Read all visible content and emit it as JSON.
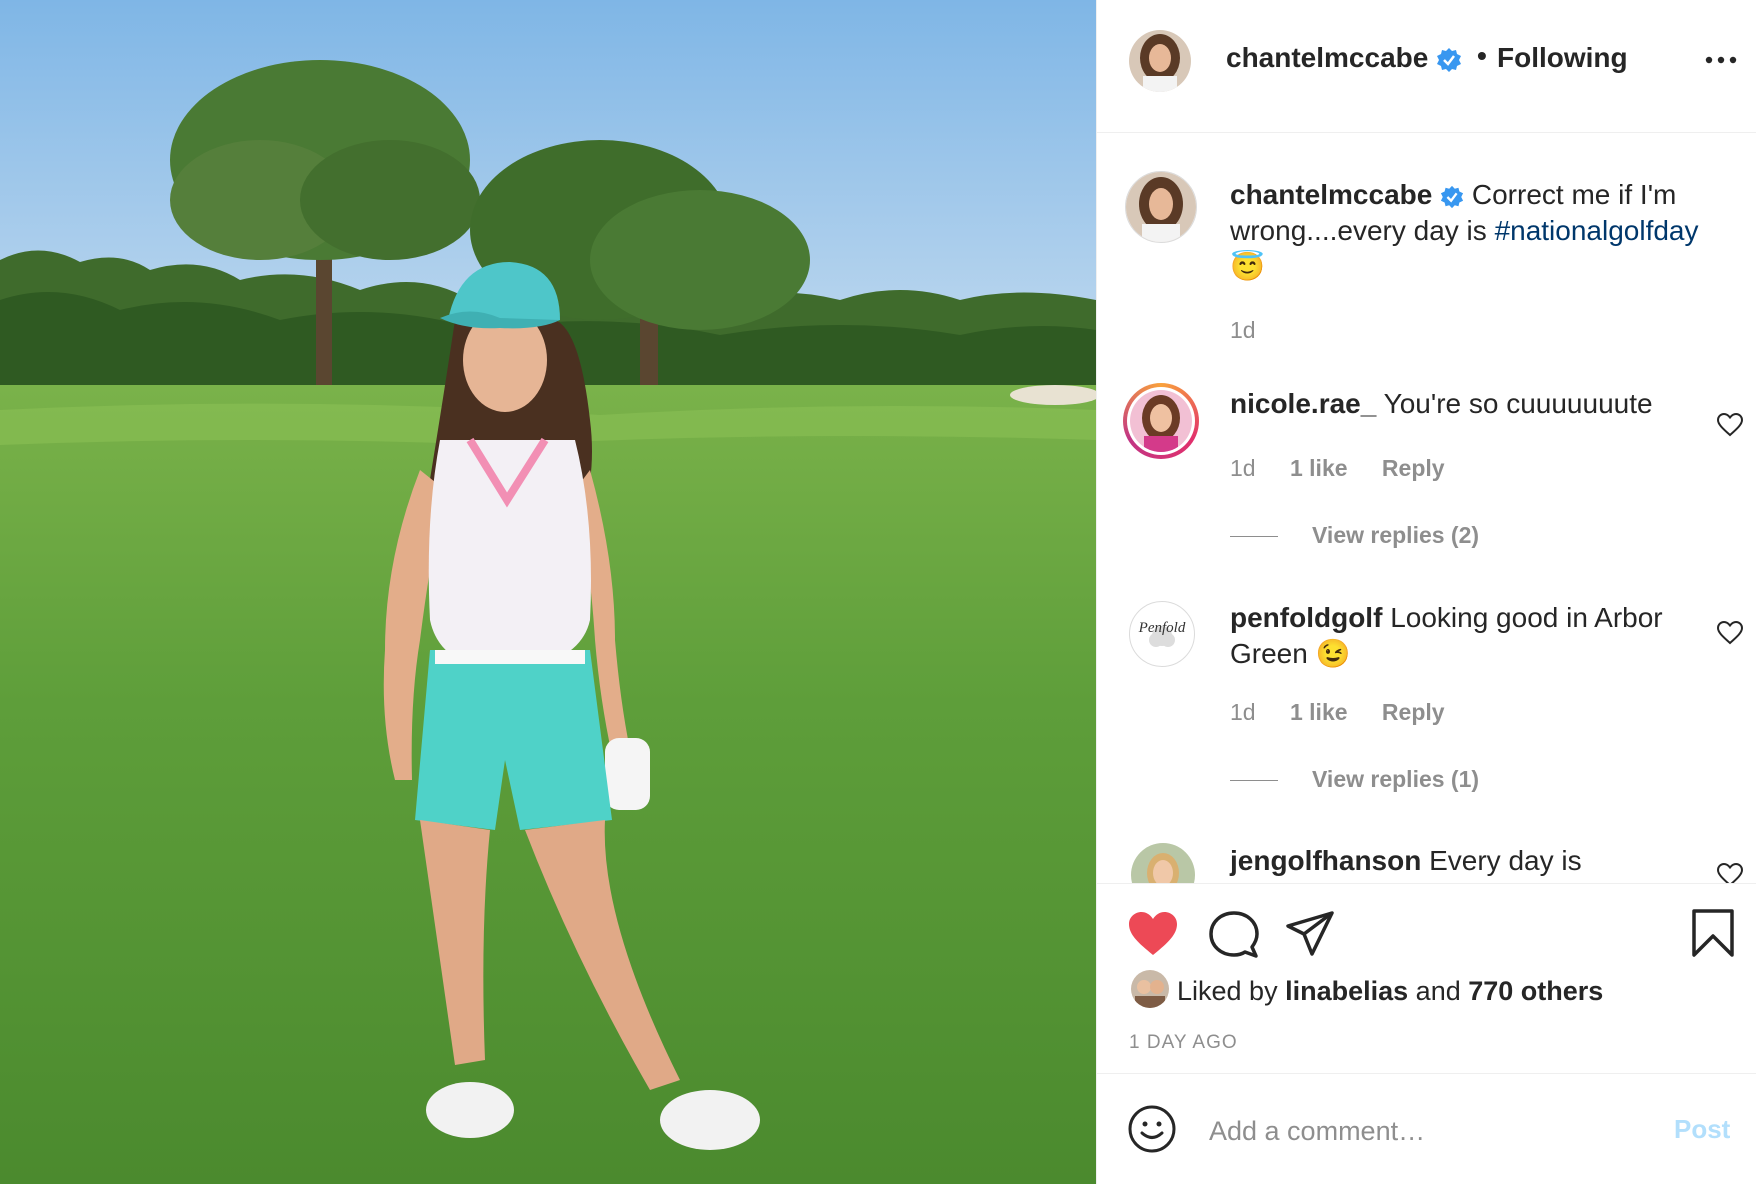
{
  "post": {
    "author": "chantelmccabe",
    "separator": "•",
    "follow_status": "Following",
    "more_icon": "more-options-icon",
    "colors": {
      "verified": "#3897f0",
      "like_red": "#ed4956",
      "link": "#00376b",
      "muted": "#8e8e8e",
      "post_disabled": "#b2dffc"
    }
  },
  "caption": {
    "username": "chantelmccabe",
    "text_before": "Correct me if I'm wrong....every day is ",
    "hashtag": "#nationalgolfday",
    "emoji": "😇",
    "time": "1d"
  },
  "comments": [
    {
      "username": "nicole.rae_",
      "text": "You're so cuuuuuuute",
      "time": "1d",
      "likes": "1 like",
      "reply": "Reply",
      "view_replies": "View replies (2)"
    },
    {
      "username": "penfoldgolf",
      "text": "Looking good in Arbor Green 😉",
      "time": "1d",
      "likes": "1 like",
      "reply": "Reply",
      "view_replies": "View replies (1)",
      "avatar_text": "Penfold"
    },
    {
      "username": "jengolfhanson",
      "text": "Every day is"
    }
  ],
  "actions": {
    "liked_by_prefix": "Liked by",
    "liked_by_user": "linabelias",
    "liked_by_and": "and",
    "liked_by_others": "770 others",
    "time_ago": "1 DAY AGO"
  },
  "add_comment": {
    "placeholder": "Add a comment…",
    "post_label": "Post"
  }
}
